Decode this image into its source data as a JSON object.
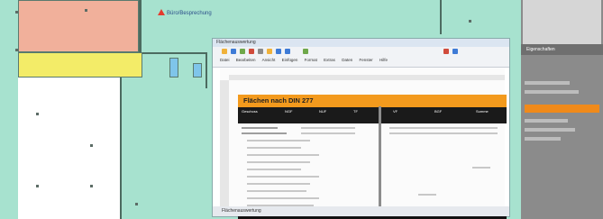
{
  "floorplan": {
    "room_label": "Büro/Besprechung",
    "room_label_color": "#2c4f8a",
    "marker_color": "#e43b2e",
    "colors": {
      "corridor": "#a7e2cf",
      "room_salmon": "#f1b09b",
      "room_yellow": "#f3ec68",
      "room_blue": "#7fc5ea"
    }
  },
  "spreadsheet": {
    "window_title": "Flächenauswertung",
    "menu": [
      "Datei",
      "Bearbeiten",
      "Ansicht",
      "Einfügen",
      "Format",
      "Extras",
      "Daten",
      "Fenster",
      "Hilfe"
    ],
    "sheet_title": "Flächen nach DIN 277",
    "header_labels": [
      "Geschoss",
      "NGF",
      "NUF",
      "TF",
      "VF",
      "BGF",
      "Summe"
    ],
    "active_tab": "Flächenauswertung",
    "accent": "#f39a1d",
    "header_bg": "#1a1a1a"
  },
  "side_panel": {
    "title": "Eigenschaften",
    "accent": "#f08a1a"
  }
}
